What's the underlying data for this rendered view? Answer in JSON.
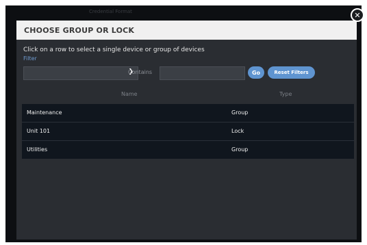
{
  "background": {
    "title": "Credential Format"
  },
  "modal": {
    "title": "CHOOSE GROUP OR LOCK",
    "instruction": "Click on a row to select a single device or group of devices",
    "filter_label": "Filter",
    "filter_select_value": "",
    "contains_label": "Contains",
    "contains_value": "",
    "go_label": "Go",
    "reset_label": "Reset Filters",
    "close_icon": "close-icon"
  },
  "table": {
    "columns": [
      "Name",
      "Type"
    ],
    "rows": [
      {
        "name": "Maintenance",
        "type": "Group"
      },
      {
        "name": "Unit 101",
        "type": "Lock"
      },
      {
        "name": "Utilities",
        "type": "Group"
      }
    ]
  },
  "colors": {
    "accent": "#5f94d0",
    "modal_bg": "#2a2d32",
    "table_bg": "#10161e",
    "header_bg": "#f0f0f0"
  }
}
